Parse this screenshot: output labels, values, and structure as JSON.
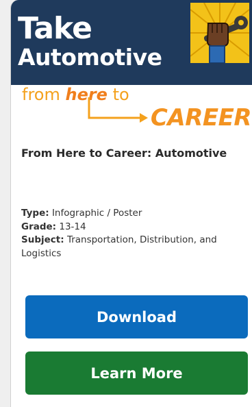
{
  "banner": {
    "title_line1": "Take",
    "title_line2": "Automotive",
    "badge_icon": "fist-wrench-icon",
    "tagline_from": "from ",
    "tagline_here": "here",
    "tagline_to": " to",
    "tagline_career": "CAREER",
    "colors": {
      "navy": "#1f3a5c",
      "yellow": "#f3c219",
      "orange": "#f39321"
    }
  },
  "product": {
    "title": "From Here to Career: Automotive",
    "type_label": "Type:",
    "type_value": "Infographic / Poster",
    "grade_label": "Grade:",
    "grade_value": "13-14",
    "subject_label": "Subject:",
    "subject_value": "Transportation, Distribution, and Logistics"
  },
  "actions": {
    "download_label": "Download",
    "learn_more_label": "Learn More",
    "download_color": "#0b6bbd",
    "learn_more_color": "#1a7b33"
  }
}
